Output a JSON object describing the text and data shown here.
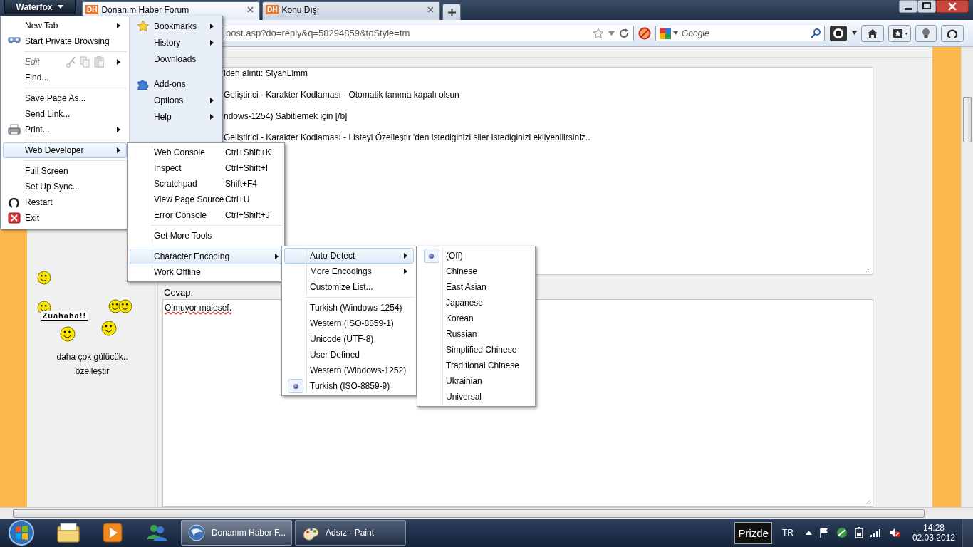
{
  "app_button": {
    "label": "Waterfox"
  },
  "tabs": [
    {
      "logo": "DH",
      "label": "Donanım Haber Forum",
      "selected": true
    },
    {
      "logo": "DH",
      "label": "Konu Dışı",
      "selected": false
    }
  ],
  "address": {
    "value": "post.asp?do=reply&q=58294859&toStyle=tm"
  },
  "search": {
    "placeholder": "Google"
  },
  "quote_lines": [
    "lden alıntı:  SiyahLimm",
    "Geliştirici - Karakter Kodlaması - Otomatik tanıma  kapalı olsun",
    "ndows-1254)  Sabitlemek için [/b]",
    "Geliştirici - Karakter Kodlaması - Listeyi Özelleştir 'den istediginizi siler istediginizi ekliyebilirsiniz.."
  ],
  "sidebar": {
    "sign": "Zuahaha!!",
    "links": [
      "daha çok gülücük..",
      "özelleştir"
    ]
  },
  "reply": {
    "label": "Cevap:",
    "value": "Olmuyor malesef."
  },
  "app_menu": {
    "left": [
      {
        "kind": "item",
        "label": "New Tab",
        "submenu": true,
        "selected": false,
        "disabled": false
      },
      {
        "kind": "item",
        "label": "Start Private Browsing",
        "submenu": false,
        "selected": false,
        "disabled": false
      },
      {
        "kind": "separator"
      },
      {
        "kind": "edit",
        "label": "Edit",
        "submenu": true,
        "selected": false,
        "disabled": true
      },
      {
        "kind": "item",
        "label": "Find...",
        "submenu": false,
        "selected": false,
        "disabled": false
      },
      {
        "kind": "separator"
      },
      {
        "kind": "item",
        "label": "Save Page As...",
        "submenu": false,
        "selected": false,
        "disabled": false
      },
      {
        "kind": "item",
        "label": "Send Link...",
        "submenu": false,
        "selected": false,
        "disabled": false
      },
      {
        "kind": "item",
        "label": "Print...",
        "submenu": true,
        "selected": false,
        "disabled": false
      },
      {
        "kind": "separator"
      },
      {
        "kind": "item",
        "label": "Web Developer",
        "submenu": true,
        "selected": true,
        "disabled": false
      },
      {
        "kind": "separator"
      },
      {
        "kind": "item",
        "label": "Full Screen",
        "submenu": false,
        "selected": false,
        "disabled": false
      },
      {
        "kind": "item",
        "label": "Set Up Sync...",
        "submenu": false,
        "selected": false,
        "disabled": false
      },
      {
        "kind": "item",
        "label": "Restart",
        "submenu": false,
        "selected": false,
        "disabled": false
      },
      {
        "kind": "item",
        "label": "Exit",
        "submenu": false,
        "selected": false,
        "disabled": false
      }
    ],
    "right": [
      {
        "kind": "item",
        "label": "Bookmarks",
        "submenu": true,
        "selected": false,
        "disabled": false
      },
      {
        "kind": "item",
        "label": "History",
        "submenu": true,
        "selected": false,
        "disabled": false
      },
      {
        "kind": "item",
        "label": "Downloads",
        "submenu": false,
        "selected": false,
        "disabled": false
      },
      {
        "kind": "separator"
      },
      {
        "kind": "item",
        "label": "Add-ons",
        "submenu": false,
        "selected": false,
        "disabled": false
      },
      {
        "kind": "item",
        "label": "Options",
        "submenu": true,
        "selected": false,
        "disabled": false
      },
      {
        "kind": "item",
        "label": "Help",
        "submenu": true,
        "selected": false,
        "disabled": false
      }
    ]
  },
  "web_developer_menu": [
    {
      "kind": "item",
      "label": "Web Console",
      "shortcut": "Ctrl+Shift+K",
      "submenu": false,
      "selected": false
    },
    {
      "kind": "item",
      "label": "Inspect",
      "shortcut": "Ctrl+Shift+I",
      "submenu": false,
      "selected": false
    },
    {
      "kind": "item",
      "label": "Scratchpad",
      "shortcut": "Shift+F4",
      "submenu": false,
      "selected": false
    },
    {
      "kind": "item",
      "label": "View Page Source",
      "shortcut": "Ctrl+U",
      "submenu": false,
      "selected": false
    },
    {
      "kind": "item",
      "label": "Error Console",
      "shortcut": "Ctrl+Shift+J",
      "submenu": false,
      "selected": false
    },
    {
      "kind": "separator"
    },
    {
      "kind": "item",
      "label": "Get More Tools",
      "submenu": false,
      "selected": false
    },
    {
      "kind": "separator"
    },
    {
      "kind": "item",
      "label": "Character Encoding",
      "submenu": true,
      "selected": true
    },
    {
      "kind": "item",
      "label": "Work Offline",
      "submenu": false,
      "selected": false
    }
  ],
  "character_encoding_menu": [
    {
      "kind": "item",
      "label": "Auto-Detect",
      "submenu": true,
      "selected": true,
      "checked": false
    },
    {
      "kind": "item",
      "label": "More Encodings",
      "submenu": true,
      "selected": false,
      "checked": false
    },
    {
      "kind": "item",
      "label": "Customize List...",
      "submenu": false,
      "selected": false,
      "checked": false
    },
    {
      "kind": "separator"
    },
    {
      "kind": "item",
      "label": "Turkish (Windows-1254)",
      "submenu": false,
      "selected": false,
      "checked": false
    },
    {
      "kind": "item",
      "label": "Western (ISO-8859-1)",
      "submenu": false,
      "selected": false,
      "checked": false
    },
    {
      "kind": "item",
      "label": "Unicode (UTF-8)",
      "submenu": false,
      "selected": false,
      "checked": false
    },
    {
      "kind": "item",
      "label": "User Defined",
      "submenu": false,
      "selected": false,
      "checked": false
    },
    {
      "kind": "item",
      "label": "Western (Windows-1252)",
      "submenu": false,
      "selected": false,
      "checked": false
    },
    {
      "kind": "item",
      "label": "Turkish (ISO-8859-9)",
      "submenu": false,
      "selected": false,
      "checked": true
    }
  ],
  "auto_detect_menu": [
    {
      "kind": "item",
      "label": "(Off)",
      "selected": false,
      "checked": true
    },
    {
      "kind": "item",
      "label": "Chinese",
      "selected": false,
      "checked": false
    },
    {
      "kind": "item",
      "label": "East Asian",
      "selected": false,
      "checked": false
    },
    {
      "kind": "item",
      "label": "Japanese",
      "selected": false,
      "checked": false
    },
    {
      "kind": "item",
      "label": "Korean",
      "selected": false,
      "checked": false
    },
    {
      "kind": "item",
      "label": "Russian",
      "selected": false,
      "checked": false
    },
    {
      "kind": "item",
      "label": "Simplified Chinese",
      "selected": false,
      "checked": false
    },
    {
      "kind": "item",
      "label": "Traditional Chinese",
      "selected": false,
      "checked": false
    },
    {
      "kind": "item",
      "label": "Ukrainian",
      "selected": false,
      "checked": false
    },
    {
      "kind": "item",
      "label": "Universal",
      "selected": false,
      "checked": false
    }
  ],
  "taskbar": {
    "windows": [
      {
        "label": "Donanım Haber F...",
        "selected": true
      },
      {
        "label": "Adsız - Paint",
        "selected": false
      }
    ],
    "toolbar_label": "Prizde",
    "language": "TR",
    "time": "14:28",
    "date": "02.03.2012"
  }
}
